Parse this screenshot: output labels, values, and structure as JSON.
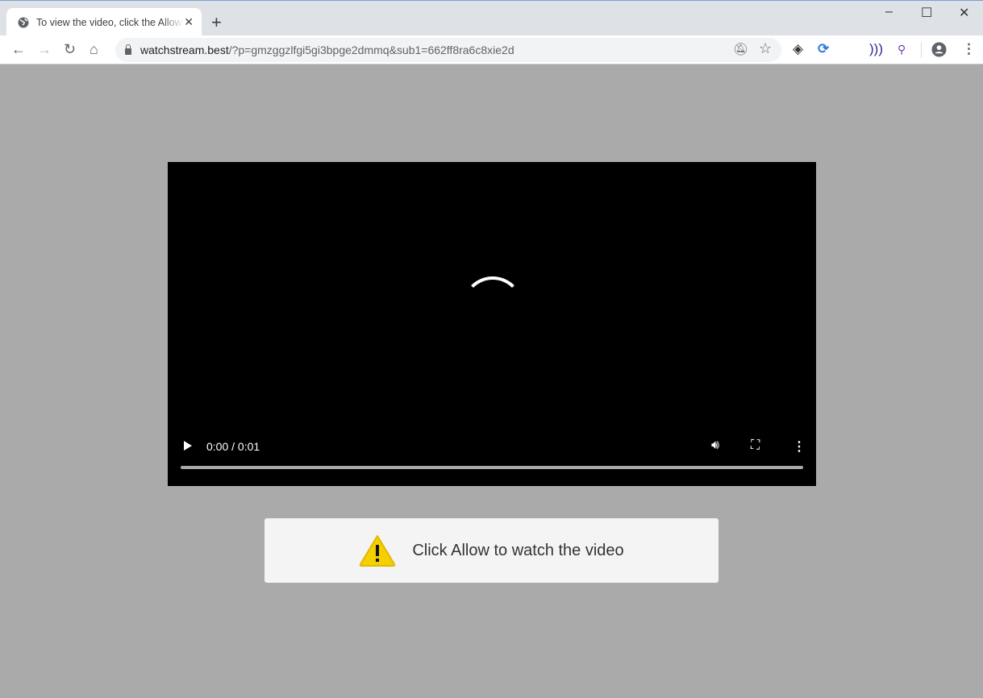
{
  "browser": {
    "tab": {
      "title": "To view the video, click the Allow button",
      "favicon": "globe-icon"
    },
    "new_tab_label": "+",
    "window_controls": {
      "minimize": "–",
      "maximize": "☐",
      "close": "✕"
    },
    "url": {
      "host": "watchstream.best",
      "path": "/?p=gmzggzlfgi5gi3bpge2dmmq&sub1=662ff8ra6c8xie2d"
    },
    "extensions": [
      "notifications-blocked-icon",
      "bookmark-star-icon",
      "extension-diamond-icon",
      "extension-sync-icon",
      "rss-icon",
      "search-extension-icon",
      "profile-icon",
      "menu-icon"
    ]
  },
  "video": {
    "time": "0:00 / 0:01",
    "progress": 0
  },
  "notice": {
    "message": "Click Allow to watch the video",
    "icon": "warning-icon",
    "icon_color": "#f5d000"
  },
  "colors": {
    "page_bg": "#aaaaaa",
    "video_bg": "#000000",
    "notice_bg": "#f4f4f4"
  }
}
